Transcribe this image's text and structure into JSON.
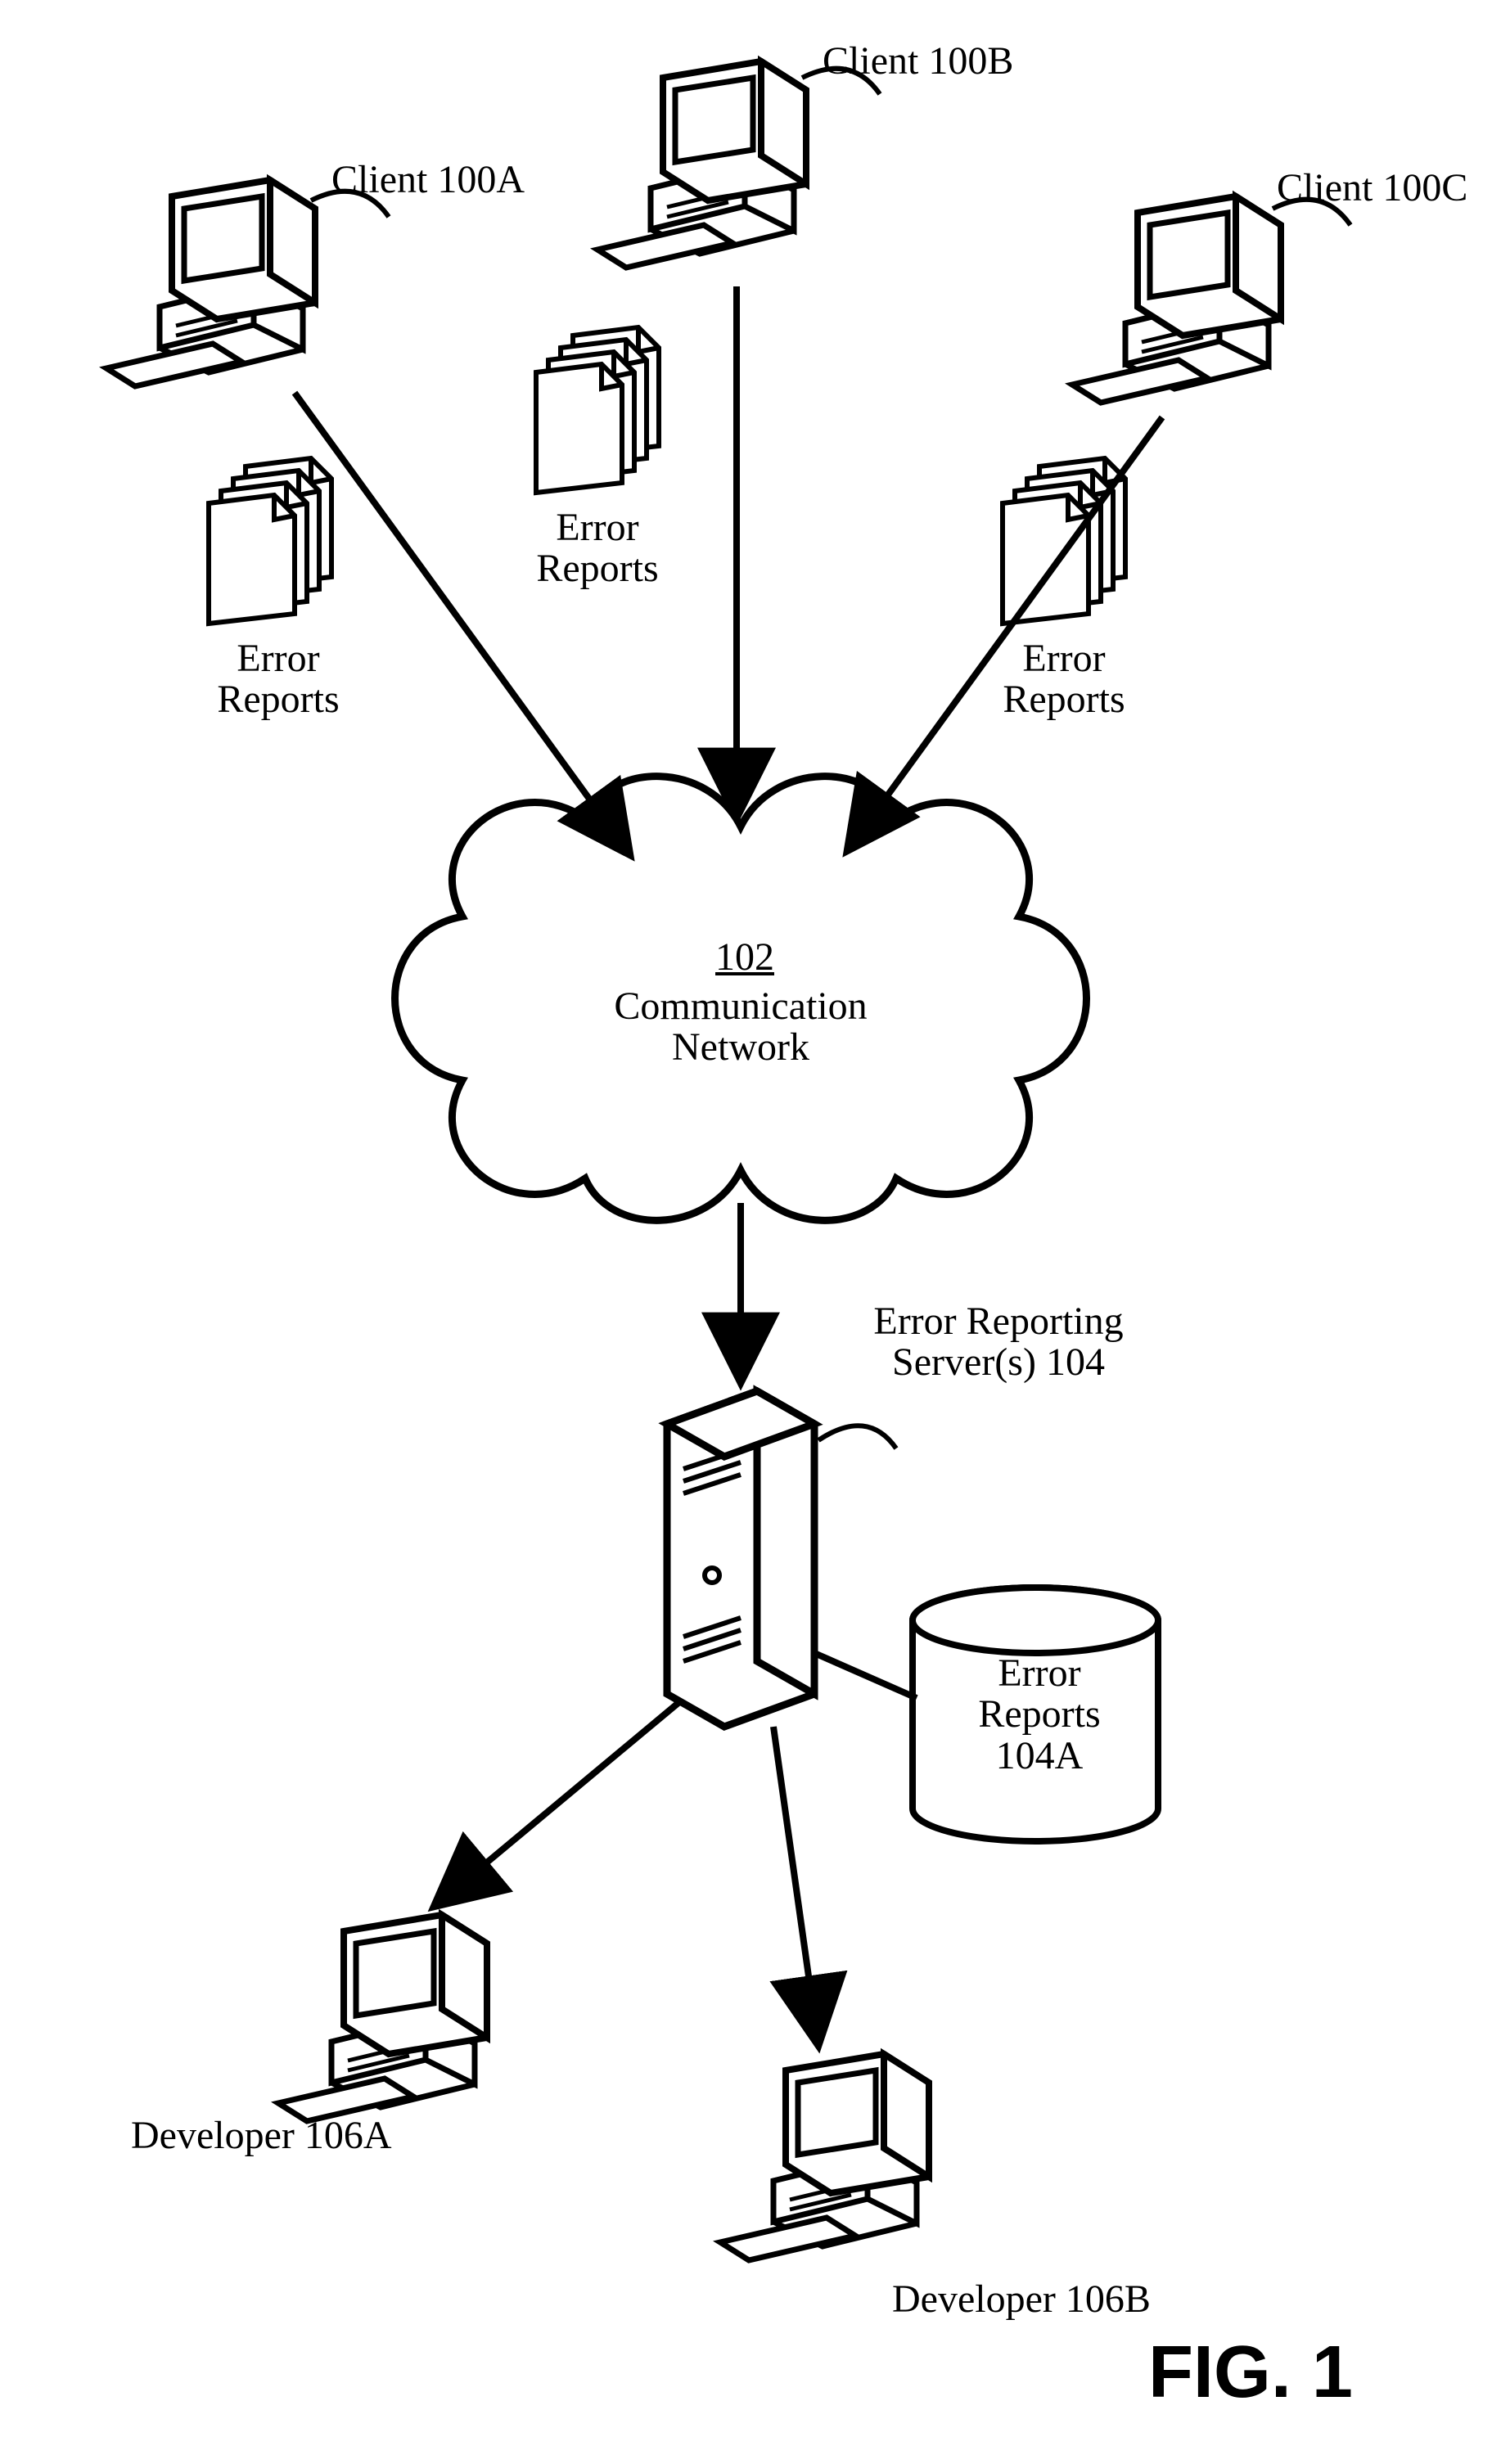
{
  "figure_label": "FIG. 1",
  "clients": {
    "a": "Client 100A",
    "b": "Client 100B",
    "c": "Client 100C"
  },
  "error_reports_label": "Error\nReports",
  "network": {
    "id": "102",
    "caption": "Communication\nNetwork"
  },
  "server_label": "Error Reporting\nServer(s) 104",
  "db_label": "Error\nReports\n104A",
  "developers": {
    "a": "Developer 106A",
    "b": "Developer 106B"
  }
}
